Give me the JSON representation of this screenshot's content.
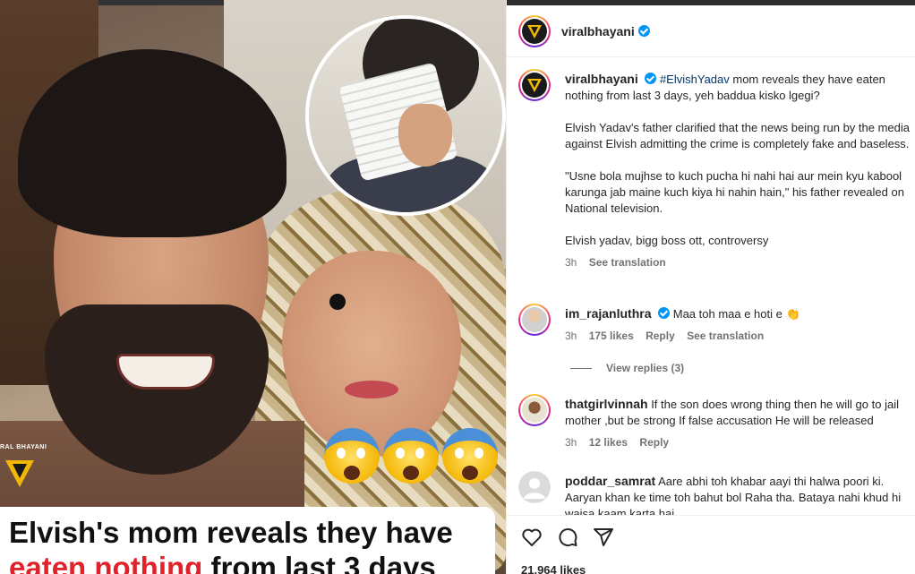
{
  "post": {
    "author": "viralbhayani",
    "likes": "21,964 likes"
  },
  "media": {
    "watermark": "RAL BHAYANI",
    "caption_line1": "Elvish's mom reveals they have",
    "caption_line2_red": "eaten nothing",
    "caption_line2_rest": " from last 3 days"
  },
  "caption": {
    "username": "viralbhayani",
    "hashtag": "#ElvishYadav",
    "line1": " mom reveals they have eaten nothing from last 3 days, yeh baddua kisko lgegi?",
    "para2": "Elvish Yadav's father clarified that the news being run by the media against Elvish admitting the crime is completely fake and baseless.",
    "para3": "\"Usne bola mujhse to kuch pucha hi nahi hai aur mein kyu kabool karunga jab maine kuch kiya hi nahin hain,\" his father revealed on National television.",
    "para4": "Elvish yadav, bigg boss ott, controversy",
    "time": "3h",
    "see_translation": "See translation"
  },
  "comments": [
    {
      "username": "im_rajanluthra",
      "text": "Maa toh maa e hoti e 👏",
      "time": "3h",
      "likes": "175 likes",
      "reply": "Reply",
      "see_translation": "See translation",
      "view_replies": "View replies (3)"
    },
    {
      "username": "thatgirlvinnah",
      "text": "If the son does wrong thing then he will go to jail mother ,but be strong If false accusation He will be released",
      "time": "3h",
      "likes": "12 likes",
      "reply": "Reply"
    },
    {
      "username": "poddar_samrat",
      "text": "Aare abhi toh khabar aayi thi halwa poori ki. Aaryan khan ke time toh bahut bol Raha tha. Bataya nahi khud hi waisa kaam karta hai"
    }
  ],
  "colors": {
    "verified": "#0095f6",
    "hashtag": "#00376b",
    "caption_red": "#e0232a"
  },
  "icons": [
    "heart-icon",
    "comment-icon",
    "share-icon",
    "verified-icon"
  ]
}
